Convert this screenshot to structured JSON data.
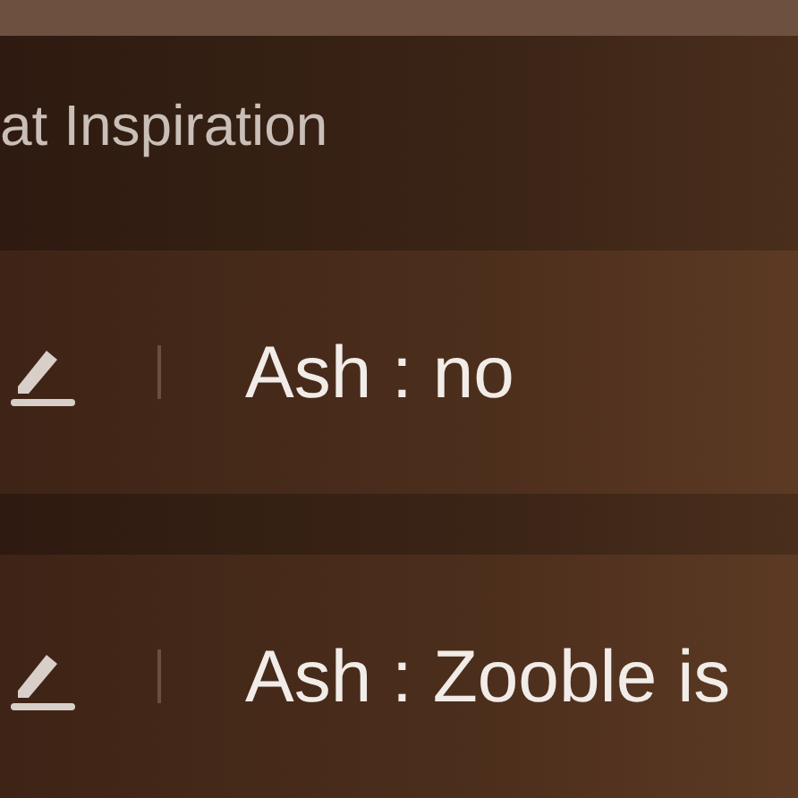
{
  "header": {
    "title": "at Inspiration"
  },
  "messages": [
    {
      "text": "Ash : no"
    },
    {
      "text": "Ash : Zooble is"
    }
  ]
}
